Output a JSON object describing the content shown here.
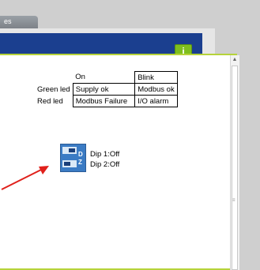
{
  "tab": {
    "label": "es"
  },
  "info_button": {
    "glyph": "i"
  },
  "led_table": {
    "headers": [
      "",
      "On",
      "Blink"
    ],
    "rows": [
      {
        "label": "Green led",
        "on": "Supply ok",
        "blink": "Modbus ok"
      },
      {
        "label": "Red led",
        "on": "Modbus Failure",
        "blink": "I/O alarm"
      }
    ]
  },
  "dip": {
    "icon_text": "DZ",
    "dip1": "Dip 1:Off",
    "dip2": "Dip 2:Off"
  },
  "colors": {
    "header": "#1b3f8f",
    "panel_border": "#b6d33a",
    "info_button": "#7fbf1e",
    "arrow": "#e0201b",
    "dip_icon": "#3b7bc4"
  }
}
